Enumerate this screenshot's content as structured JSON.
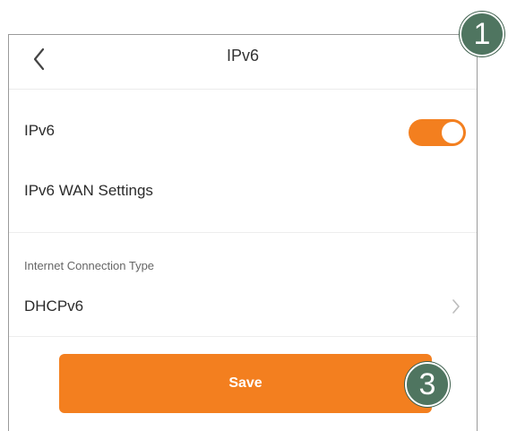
{
  "header": {
    "title": "IPv6",
    "back_icon": "chevron-left-icon"
  },
  "ipv6_toggle": {
    "label": "IPv6",
    "state": "on",
    "accent": "#f37f1f"
  },
  "wan_settings": {
    "heading": "IPv6 WAN Settings"
  },
  "connection_type": {
    "label": "Internet Connection Type",
    "value": "DHCPv6",
    "icon": "chevron-right-icon"
  },
  "save_button": {
    "label": "Save",
    "color": "#f37f1f"
  },
  "callouts": [
    {
      "number": "1",
      "color": "#4f7560"
    },
    {
      "number": "3",
      "color": "#4f7560"
    }
  ]
}
